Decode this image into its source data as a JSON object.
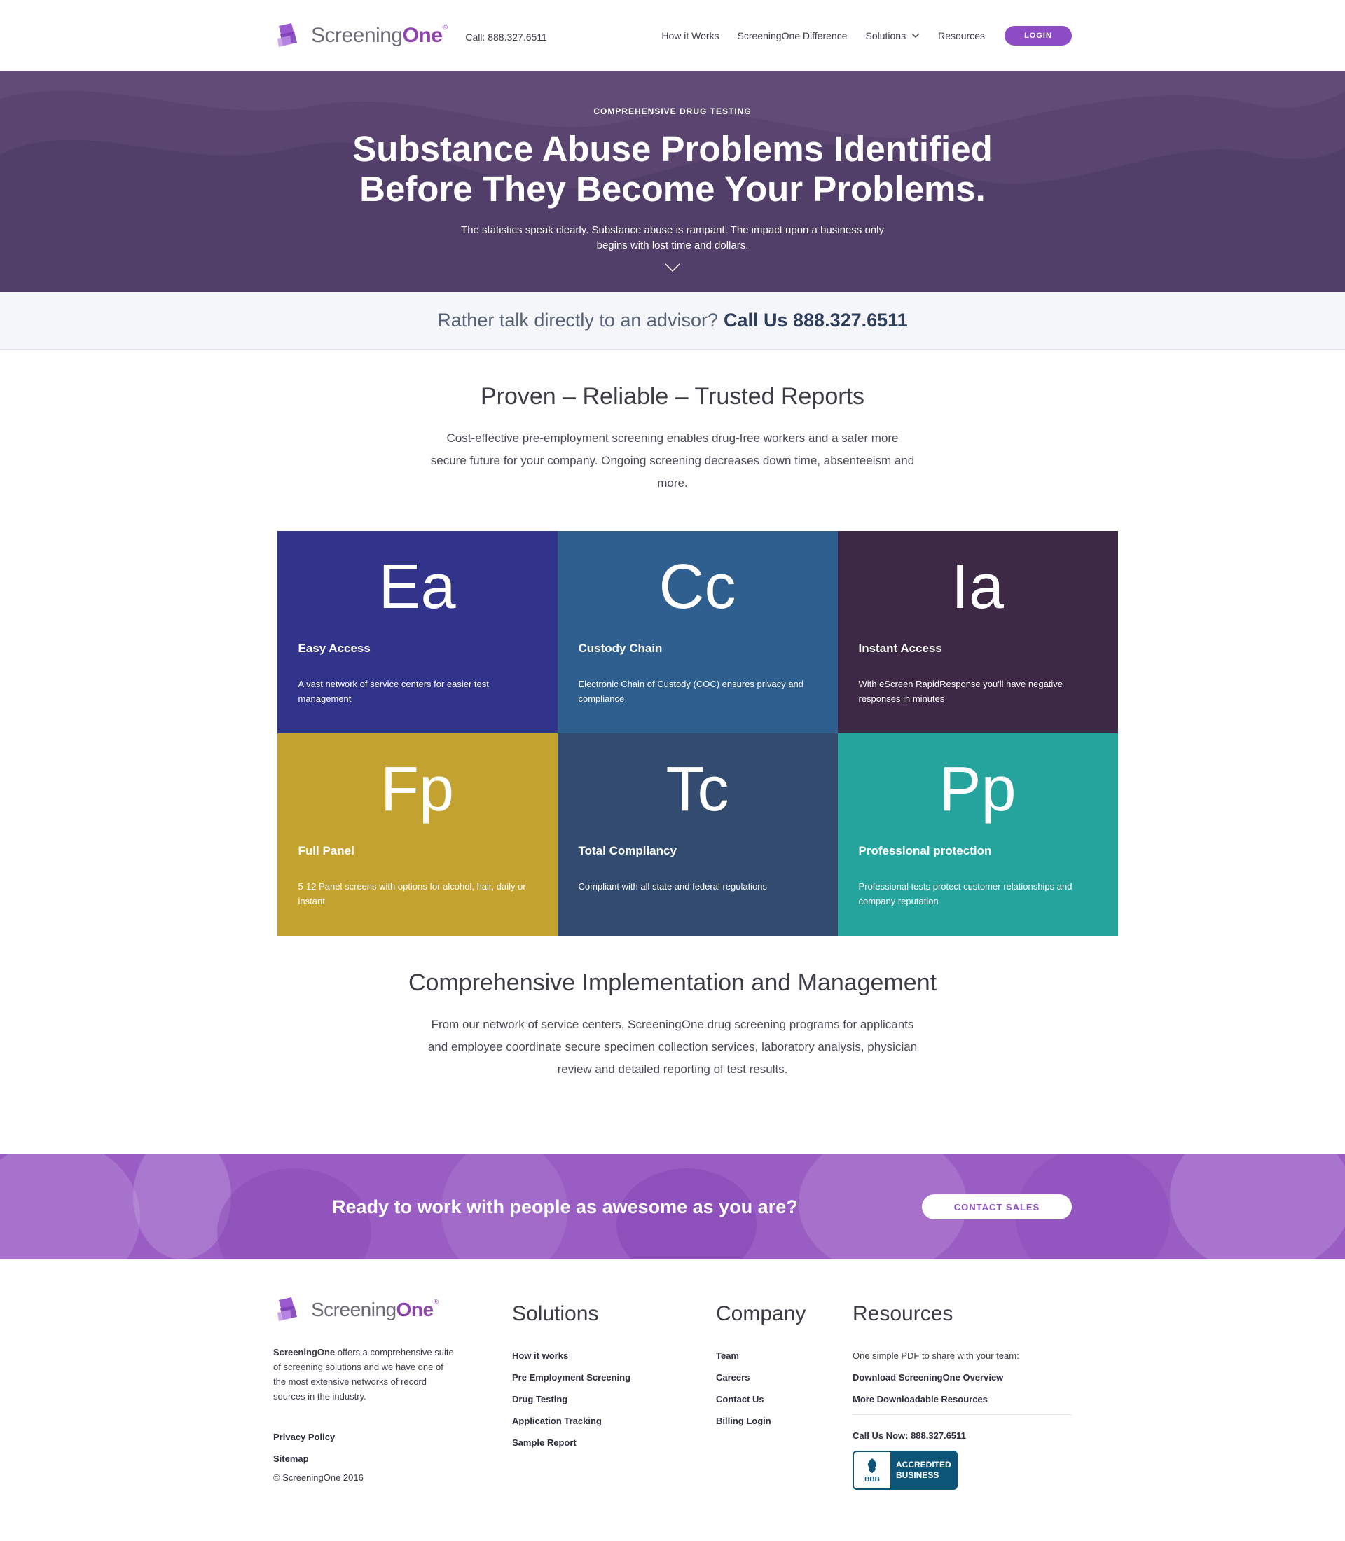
{
  "header": {
    "logo_main": "Screening",
    "logo_accent": "One",
    "logo_reg": "®",
    "phone": "Call: 888.327.6511",
    "nav": [
      {
        "label": "How it Works"
      },
      {
        "label": "ScreeningOne Difference"
      },
      {
        "label": "Solutions"
      },
      {
        "label": "Resources"
      }
    ],
    "login_label": "LOGIN"
  },
  "hero": {
    "eyebrow": "COMPREHENSIVE DRUG TESTING",
    "title": "Substance Abuse Problems Identified Before They Become Your Problems.",
    "subtitle": "The statistics speak clearly. Substance abuse is rampant. The impact upon a business only begins with lost time and dollars."
  },
  "callbar": {
    "prompt": "Rather talk directly to an advisor?",
    "cta": "Call Us 888.327.6511"
  },
  "intro": {
    "title": "Proven – Reliable – Trusted Reports",
    "text": "Cost-effective pre-employment screening enables drug-free workers and a safer more secure future for your company. Ongoing screening decreases down time, absenteeism and more."
  },
  "tiles": [
    {
      "abbr": "Ea",
      "name": "Easy Access",
      "desc": "A vast network of service centers for easier test management",
      "color": "#32348c"
    },
    {
      "abbr": "Cc",
      "name": "Custody Chain",
      "desc": "Electronic Chain of Custody (COC) ensures privacy and compliance",
      "color": "#2f5f8e"
    },
    {
      "abbr": "Ia",
      "name": "Instant Access",
      "desc": "With eScreen RapidResponse you'll have negative responses in minutes",
      "color": "#3d2845"
    },
    {
      "abbr": "Fp",
      "name": "Full Panel",
      "desc": "5-12 Panel screens with options for alcohol, hair, daily or instant",
      "color": "#c4a22f"
    },
    {
      "abbr": "Tc",
      "name": "Total Compliancy",
      "desc": "Compliant with all state and federal regulations",
      "color": "#324b6e"
    },
    {
      "abbr": "Pp",
      "name": "Professional protection",
      "desc": "Professional tests protect customer relationships and company reputation",
      "color": "#24a49c"
    }
  ],
  "impl": {
    "title": "Comprehensive Implementation and Management",
    "text": "From our network of service centers, ScreeningOne drug screening programs for applicants and employee coordinate secure specimen collection services, laboratory analysis, physician review and detailed reporting of test results."
  },
  "cta": {
    "text": "Ready to work with people as awesome as you are?",
    "button": "CONTACT SALES"
  },
  "footer": {
    "about_brand": "ScreeningOne",
    "about_text": " offers a comprehensive suite of screening solutions and we have one of the most extensive networks of record sources in the industry.",
    "privacy": "Privacy Policy",
    "sitemap": "Sitemap",
    "copyright": "© ScreeningOne 2016",
    "solutions": {
      "heading": "Solutions",
      "links": [
        "How it works",
        "Pre Employment Screening",
        "Drug Testing",
        "Application Tracking",
        "Sample Report"
      ]
    },
    "company": {
      "heading": "Company",
      "links": [
        "Team",
        "Careers",
        "Contact Us",
        "Billing Login"
      ]
    },
    "resources": {
      "heading": "Resources",
      "note": "One simple PDF to share with your team:",
      "links": [
        "Download ScreeningOne Overview",
        "More Downloadable Resources"
      ],
      "call": "Call Us Now: 888.327.6511",
      "bbb_mark": "BBB",
      "bbb_line1": "ACCREDITED",
      "bbb_line2": "BUSINESS"
    }
  }
}
